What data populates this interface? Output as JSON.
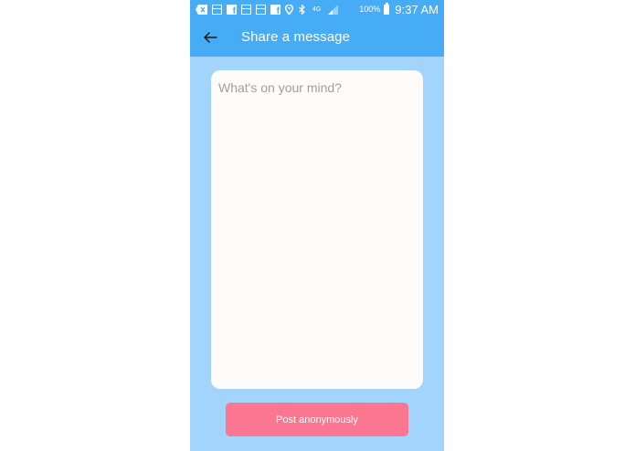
{
  "status_bar": {
    "icons": [
      "back-notification-icon",
      "calendar-icon",
      "facebook-icon",
      "calendar-icon",
      "calendar-icon",
      "facebook-icon",
      "location-pin-icon",
      "bluetooth-icon",
      "network-4g-icon",
      "signal-icon"
    ],
    "network_label": "4G",
    "battery_percent": "100%",
    "time": "9:37 AM"
  },
  "app_bar": {
    "back_icon": "arrow-left-icon",
    "title": "Share a message"
  },
  "composer": {
    "value": "",
    "placeholder": "What's on your mind?"
  },
  "post_button": {
    "label": "Post anonymously"
  },
  "colors": {
    "app_bar": "#47acf6",
    "background": "#a3d4fc",
    "card": "#fdfcfa",
    "post_button": "#fa7691",
    "placeholder": "#9e9e9e"
  }
}
